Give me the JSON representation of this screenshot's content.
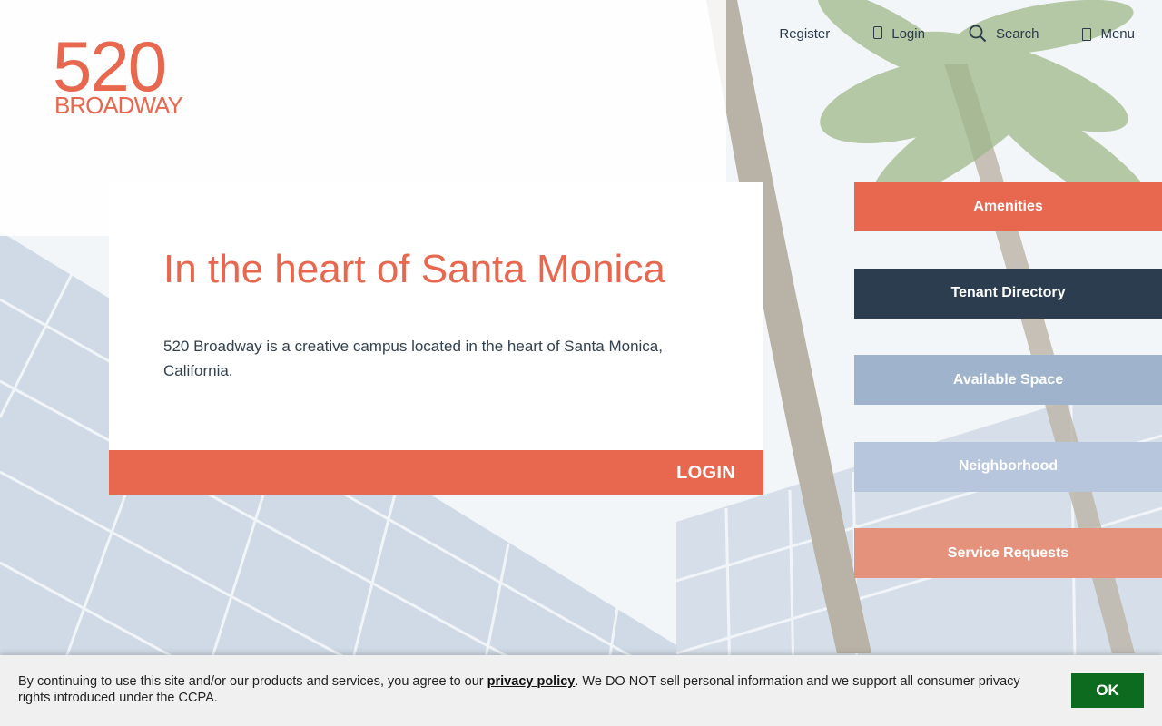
{
  "logo": {
    "number": "520",
    "word": "BROADWAY"
  },
  "topnav": {
    "register": "Register",
    "login": "Login",
    "search": "Search",
    "menu": "Menu"
  },
  "hero": {
    "title": "In the heart of Santa Monica",
    "description": "520 Broadway is a creative campus located in the heart of Santa Monica, California.",
    "login_label": "LOGIN"
  },
  "side_buttons": [
    {
      "label": "Amenities",
      "color": "#e8674f"
    },
    {
      "label": "Tenant Directory",
      "color": "#2b3d4f"
    },
    {
      "label": "Available Space",
      "color": "#9fb3cd"
    },
    {
      "label": "Neighborhood",
      "color": "#b7c6dc"
    },
    {
      "label": "Service Requests",
      "color": "#e4927c"
    }
  ],
  "cookie": {
    "text_before": "By continuing to use this site and/or our products and services, you agree to our ",
    "link": "privacy policy",
    "text_after": ". We DO NOT sell personal information and we support all consumer privacy rights introduced under the CCPA.",
    "ok_label": "OK"
  },
  "colors": {
    "accent": "#e8674f",
    "ok_green": "#0d6b1f"
  }
}
